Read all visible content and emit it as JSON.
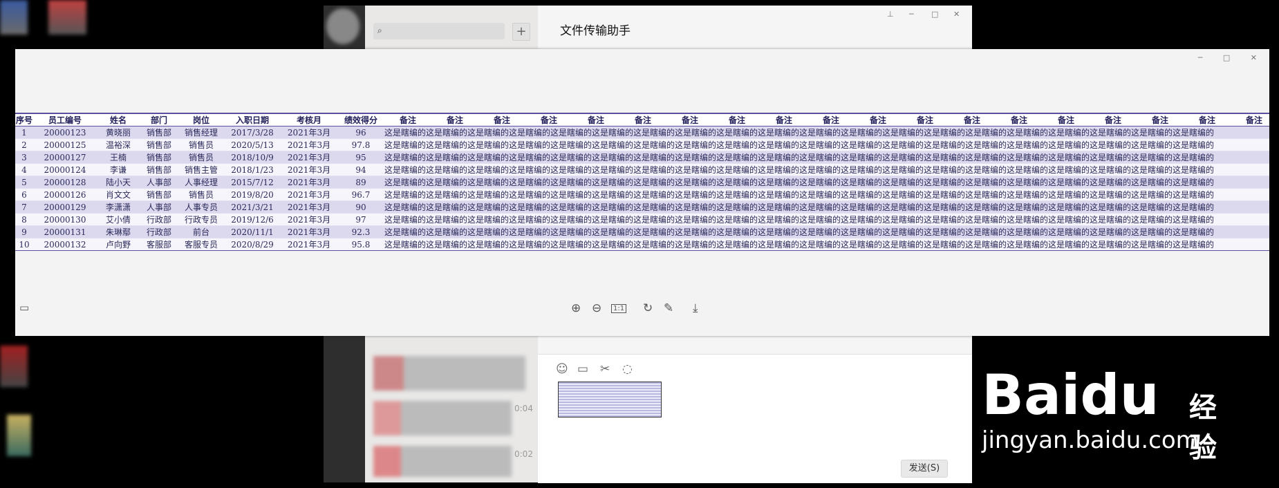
{
  "chat": {
    "title": "文件传输助手",
    "send_label": "发送(S)",
    "list_time_1": "0:04",
    "list_time_2": "0:02",
    "window_controls": [
      "⊥",
      "─",
      "□",
      "✕"
    ]
  },
  "viewer": {
    "window_controls": [
      "─",
      "□",
      "✕"
    ],
    "tools": {
      "zoom_in": "⊕",
      "zoom_out": "⊖",
      "actual_size": "1:1",
      "rotate": "↻",
      "edit": "✎",
      "download": "⤓",
      "thumbs": "▭"
    }
  },
  "sheet": {
    "headers": [
      "序号",
      "员工编号",
      "姓名",
      "部门",
      "岗位",
      "入职日期",
      "考核月",
      "绩效得分"
    ],
    "note_header": "备注",
    "note_text": "这是瞎编的这是瞎编的这是瞎编的这是瞎编的这是瞎编的这是瞎编的这是瞎编的这是瞎编的这是瞎编的这是瞎编的这是瞎编的这是瞎编的这是瞎编的这是瞎编的这是瞎编的这是瞎编的这是瞎编的这是瞎编的这是瞎编的这是瞎编的",
    "rows": [
      [
        "1",
        "20000123",
        "黄晓丽",
        "销售部",
        "销售经理",
        "2017/3/28",
        "2021年3月",
        "96"
      ],
      [
        "2",
        "20000125",
        "温裕深",
        "销售部",
        "销售员",
        "2020/5/13",
        "2021年3月",
        "97.8"
      ],
      [
        "3",
        "20000127",
        "王楠",
        "销售部",
        "销售员",
        "2018/10/9",
        "2021年3月",
        "95"
      ],
      [
        "4",
        "20000124",
        "李谦",
        "销售部",
        "销售主管",
        "2018/1/23",
        "2021年3月",
        "94"
      ],
      [
        "5",
        "20000128",
        "陆小天",
        "人事部",
        "人事经理",
        "2015/7/12",
        "2021年3月",
        "89"
      ],
      [
        "6",
        "20000126",
        "肖文文",
        "销售部",
        "销售员",
        "2019/8/20",
        "2021年3月",
        "96.7"
      ],
      [
        "7",
        "20000129",
        "李潇潇",
        "人事部",
        "人事专员",
        "2021/3/21",
        "2021年3月",
        "90"
      ],
      [
        "8",
        "20000130",
        "艾小倩",
        "行政部",
        "行政专员",
        "2019/12/6",
        "2021年3月",
        "97"
      ],
      [
        "9",
        "20000131",
        "朱琳鄢",
        "行政部",
        "前台",
        "2020/11/1",
        "2021年3月",
        "92.3"
      ],
      [
        "10",
        "20000132",
        "卢向野",
        "客服部",
        "客服专员",
        "2020/8/29",
        "2021年3月",
        "95.8"
      ]
    ]
  },
  "brand": {
    "logo": "Bai",
    "logo_paw": "du",
    "cn": "经验",
    "url": "jingyan.baidu.com"
  }
}
